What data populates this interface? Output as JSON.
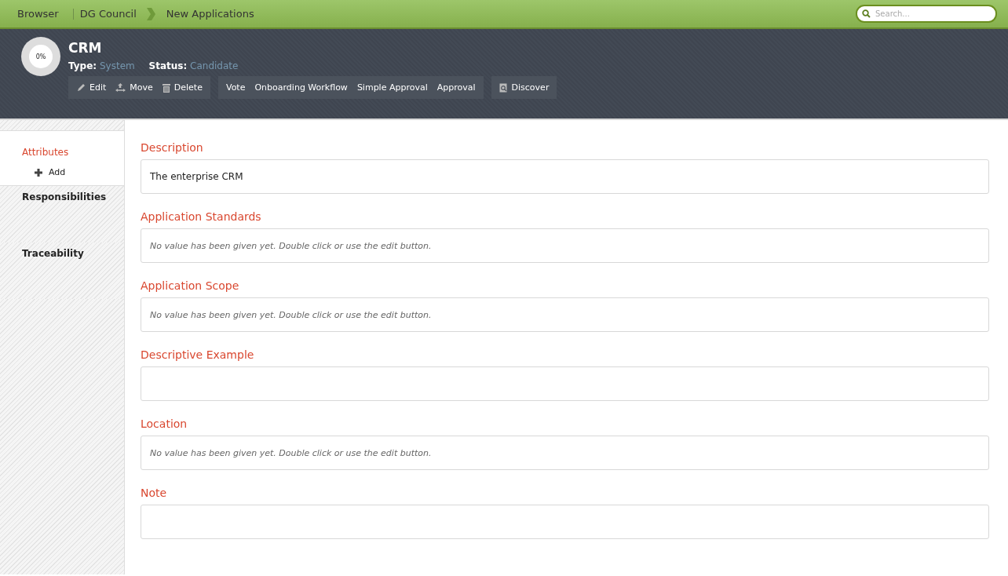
{
  "breadcrumb": {
    "root": "Browser",
    "items": [
      "DG Council",
      "New Applications"
    ]
  },
  "search": {
    "placeholder": "Search..."
  },
  "header": {
    "progress": "0%",
    "title": "CRM",
    "type_label": "Type:",
    "type_value": "System",
    "status_label": "Status:",
    "status_value": "Candidate"
  },
  "action_groups": [
    [
      {
        "label": "Edit",
        "kind": "edit"
      },
      {
        "label": "Move",
        "kind": "move"
      },
      {
        "label": "Delete",
        "kind": "delete"
      }
    ],
    [
      {
        "label": "Vote",
        "kind": "text"
      },
      {
        "label": "Onboarding Workflow",
        "kind": "text"
      },
      {
        "label": "Simple Approval",
        "kind": "text"
      },
      {
        "label": "Approval",
        "kind": "text"
      }
    ],
    [
      {
        "label": "Discover",
        "kind": "discover"
      }
    ]
  ],
  "sidebar": {
    "items": [
      {
        "label": "Attributes",
        "selected": true,
        "action": "Add"
      },
      {
        "label": "Responsibilities",
        "selected": false
      },
      {
        "label": "Traceability",
        "selected": false
      }
    ]
  },
  "fields": [
    {
      "label": "Description",
      "value": "The enterprise CRM"
    },
    {
      "label": "Application Standards",
      "placeholder": "No value has been given yet. Double click or use the edit button."
    },
    {
      "label": "Application Scope",
      "placeholder": "No value has been given yet. Double click or use the edit button."
    },
    {
      "label": "Descriptive Example"
    },
    {
      "label": "Location",
      "placeholder": "No value has been given yet. Double click or use the edit button."
    },
    {
      "label": "Note"
    }
  ]
}
